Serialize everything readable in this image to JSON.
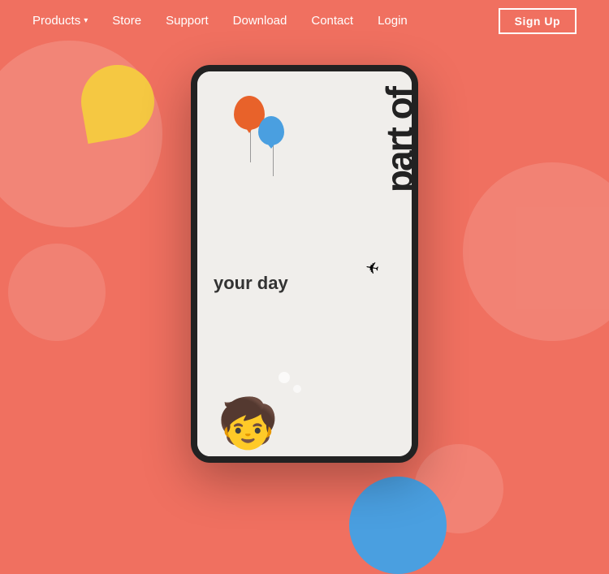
{
  "nav": {
    "items": [
      {
        "label": "Products",
        "hasDropdown": true
      },
      {
        "label": "Store",
        "hasDropdown": false
      },
      {
        "label": "Support",
        "hasDropdown": false
      },
      {
        "label": "Download",
        "hasDropdown": false
      },
      {
        "label": "Contact",
        "hasDropdown": false
      },
      {
        "label": "Login",
        "hasDropdown": false
      }
    ],
    "signup_label": "Sign Up"
  },
  "hero": {
    "vertical_text": "part of",
    "your_day_text": "your day"
  }
}
